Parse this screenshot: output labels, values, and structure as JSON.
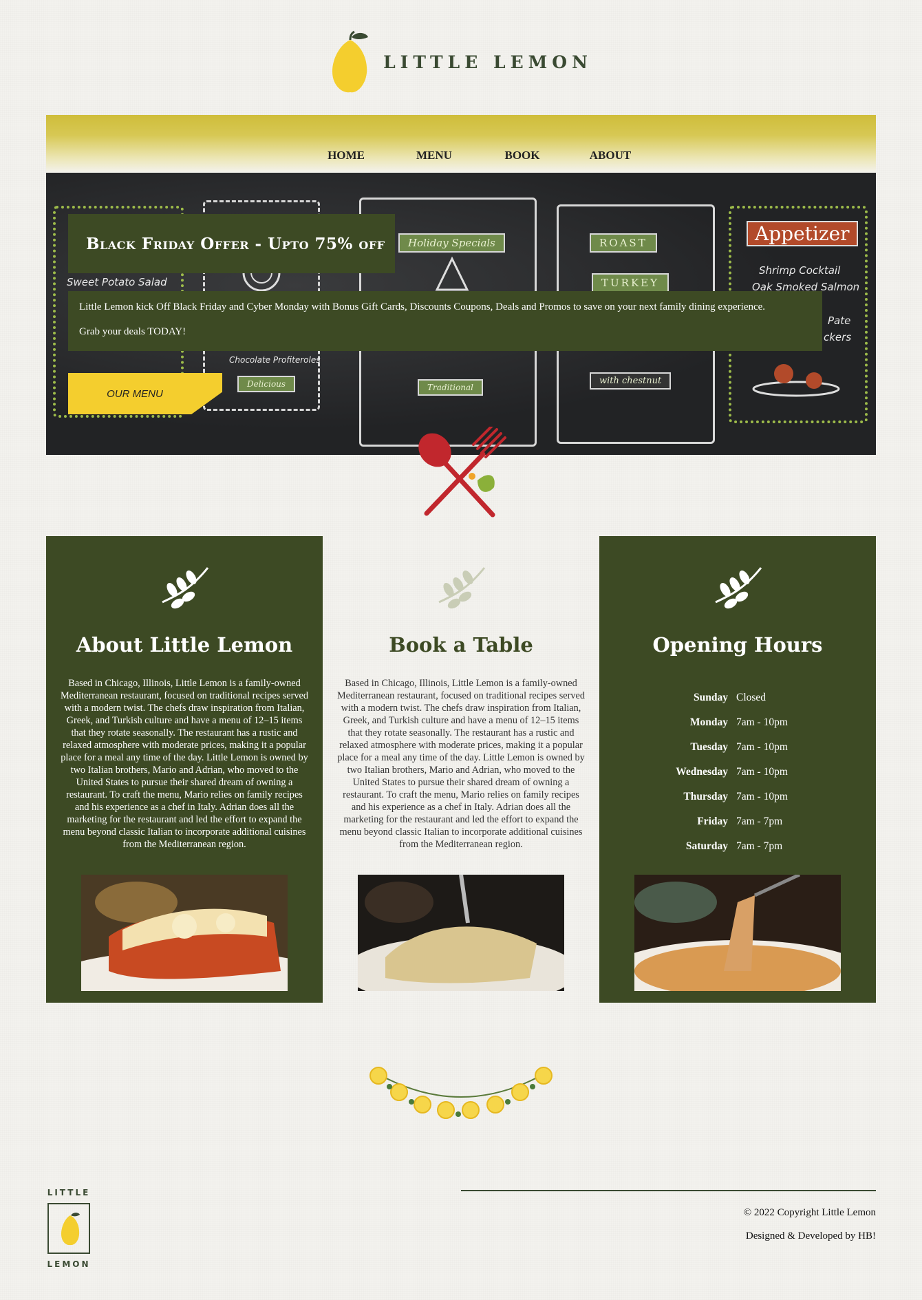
{
  "brand": {
    "name": "LITTLE LEMON",
    "footer_word_top": "LITTLE",
    "footer_word_bottom": "LEMON"
  },
  "nav": {
    "items": [
      "HOME",
      "MENU",
      "BOOK",
      "ABOUT"
    ]
  },
  "hero": {
    "offer_title": "Black Friday Offer - Upto 75% off",
    "promo_line1": "Little Lemon kick Off Black Friday and Cyber Monday with Bonus Gift Cards, Discounts Coupons, Deals and Promos to save on your next family dining experience.",
    "promo_line2": "Grab your deals TODAY!",
    "menu_button": "OUR MENU",
    "chalk": {
      "holiday": "Holiday Specials",
      "roast": "ROAST",
      "turkey": "TURKEY",
      "appetizer": "Appetizer",
      "app_item1": "Shrimp Cocktail",
      "app_item2": "Oak Smoked Salmon",
      "app_item3": "Pate",
      "app_item4": "ckers",
      "chocolate": "Chocolate Profiteroles",
      "delicious": "Delicious",
      "traditional": "Traditional",
      "chestnut": "with chestnut",
      "salad": "Sweet Potato Salad"
    }
  },
  "about": {
    "title": "About Little Lemon",
    "text": "Based in Chicago, Illinois, Little Lemon is a family-owned Mediterranean restaurant, focused on traditional recipes served with a modern twist. The chefs draw inspiration from Italian, Greek, and Turkish culture and have a menu of 12–15 items that they rotate seasonally. The restaurant has a rustic and relaxed atmosphere with moderate prices, making it a popular place for a meal any time of the day. Little Lemon is owned by two Italian brothers, Mario and Adrian, who moved to the United States to pursue their shared dream of owning a restaurant. To craft the menu, Mario relies on family recipes and his experience as a chef in Italy. Adrian does all the marketing for the restaurant and led the effort to expand the menu beyond classic Italian to incorporate additional cuisines from the Mediterranean region."
  },
  "book": {
    "title": "Book a Table",
    "text": "Based in Chicago, Illinois, Little Lemon is a family-owned Mediterranean restaurant, focused on traditional recipes served with a modern twist. The chefs draw inspiration from Italian, Greek, and Turkish culture and have a menu of 12–15 items that they rotate seasonally. The restaurant has a rustic and relaxed atmosphere with moderate prices, making it a popular place for a meal any time of the day. Little Lemon is owned by two Italian brothers, Mario and Adrian, who moved to the United States to pursue their shared dream of owning a restaurant. To craft the menu, Mario relies on family recipes and his experience as a chef in Italy. Adrian does all the marketing for the restaurant and led the effort to expand the menu beyond classic Italian to incorporate additional cuisines from the Mediterranean region."
  },
  "hours": {
    "title": "Opening Hours",
    "rows": [
      {
        "day": "Sunday",
        "time": "Closed"
      },
      {
        "day": "Monday",
        "time": "7am - 10pm"
      },
      {
        "day": "Tuesday",
        "time": "7am - 10pm"
      },
      {
        "day": "Wednesday",
        "time": "7am - 10pm"
      },
      {
        "day": "Thursday",
        "time": "7am - 10pm"
      },
      {
        "day": "Friday",
        "time": "7am - 7pm"
      },
      {
        "day": "Saturday",
        "time": "7am - 7pm"
      }
    ]
  },
  "footer": {
    "copyright": "© 2022 Copyright Little Lemon",
    "credit": "Designed & Developed by HB!"
  },
  "colors": {
    "olive": "#3d4a24",
    "lemon": "#f4ce2e",
    "nav_gold": "#cfbd3a",
    "chalkboard": "#222325"
  },
  "icons": [
    "lemon-logo-icon",
    "cutlery-icon",
    "herb-sprig-icon",
    "lemon-garland-icon"
  ]
}
